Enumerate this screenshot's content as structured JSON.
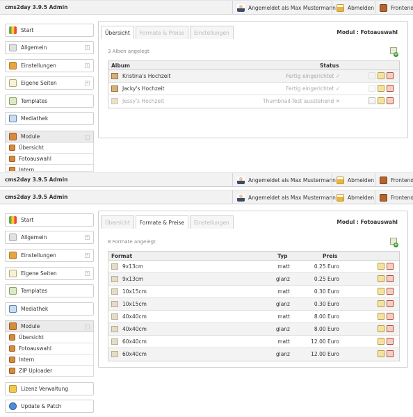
{
  "app_title": "cms2day 3.9.5 Admin",
  "topbar": {
    "logged_in": "Angemeldet als Max Mustermann",
    "logout": "Abmelden",
    "frontend": "Frontend"
  },
  "sidebar": {
    "start": "Start",
    "allgemein": "Allgemein",
    "einstellungen": "Einstellungen",
    "eigene_seiten": "Eigene Seiten",
    "templates": "Templates",
    "mediathek": "Mediathek",
    "module": "Module",
    "lizenz": "Lizenz Verwaltung",
    "update": "Update & Patch"
  },
  "modules": [
    "Übersicht",
    "Fotoauswahl",
    "Intern",
    "ZIP Uploader"
  ],
  "tabs": {
    "overview": "Übersicht",
    "formats": "Formate & Preise",
    "settings": "Einstellungen"
  },
  "modul_label": "Modul : Fotoauswahl",
  "screen1": {
    "count": "3 Alben angelegt",
    "headers": {
      "album": "Album",
      "status": "Status"
    },
    "rows": [
      {
        "name": "Kristina's Hochzeit",
        "status": "Fertig eingerichtet ✓"
      },
      {
        "name": "Jacky's Hochzeit",
        "status": "Fertig eingerichtet ✓"
      },
      {
        "name": "Jessy's Hochzeit",
        "status": "Thumbnail-Test ausstehend ✕"
      }
    ]
  },
  "screen2": {
    "count": "8 Formate angelegt",
    "headers": {
      "format": "Format",
      "typ": "Typ",
      "preis": "Preis"
    },
    "rows": [
      {
        "format": "9x13cm",
        "typ": "matt",
        "preis": "0.25 Euro"
      },
      {
        "format": "9x13cm",
        "typ": "glanz",
        "preis": "0.25 Euro"
      },
      {
        "format": "10x15cm",
        "typ": "matt",
        "preis": "0.30 Euro"
      },
      {
        "format": "10x15cm",
        "typ": "glanz",
        "preis": "0.30 Euro"
      },
      {
        "format": "40x40cm",
        "typ": "matt",
        "preis": "8.00 Euro"
      },
      {
        "format": "40x40cm",
        "typ": "glanz",
        "preis": "8.00 Euro"
      },
      {
        "format": "60x40cm",
        "typ": "matt",
        "preis": "12.00 Euro"
      },
      {
        "format": "60x40cm",
        "typ": "glanz",
        "preis": "12.00 Euro"
      }
    ]
  }
}
